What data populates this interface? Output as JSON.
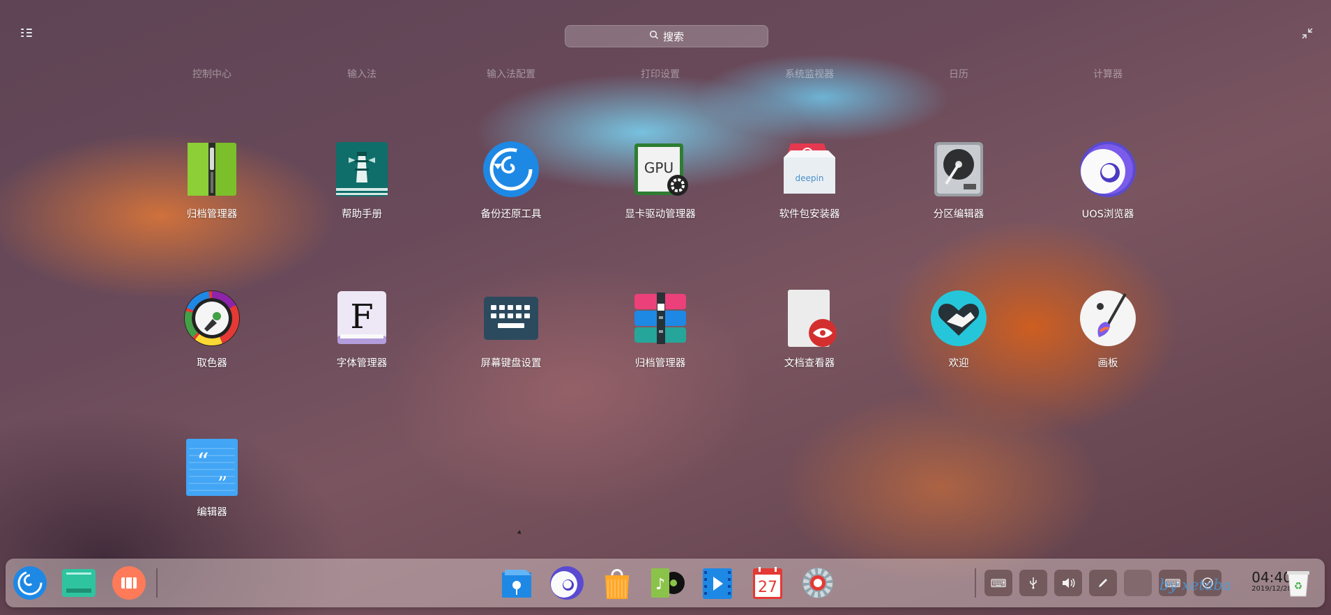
{
  "search": {
    "label": "搜索",
    "icon": "search-icon"
  },
  "categories": [
    "控制中心",
    "输入法",
    "输入法配置",
    "打印设置",
    "系统监视器",
    "日历",
    "计算器"
  ],
  "apps": [
    {
      "label": "归档管理器",
      "icon": "archive-manager-icon"
    },
    {
      "label": "帮助手册",
      "icon": "help-manual-icon"
    },
    {
      "label": "备份还原工具",
      "icon": "backup-restore-icon"
    },
    {
      "label": "显卡驱动管理器",
      "icon": "gpu-driver-manager-icon"
    },
    {
      "label": "软件包安装器",
      "icon": "package-installer-icon"
    },
    {
      "label": "分区编辑器",
      "icon": "partition-editor-icon"
    },
    {
      "label": "UOS浏览器",
      "icon": "uos-browser-icon"
    },
    {
      "label": "取色器",
      "icon": "color-picker-icon"
    },
    {
      "label": "字体管理器",
      "icon": "font-manager-icon"
    },
    {
      "label": "屏幕键盘设置",
      "icon": "onscreen-keyboard-icon"
    },
    {
      "label": "归档管理器",
      "icon": "archive-manager-alt-icon"
    },
    {
      "label": "文档查看器",
      "icon": "document-viewer-icon"
    },
    {
      "label": "欢迎",
      "icon": "welcome-icon"
    },
    {
      "label": "画板",
      "icon": "draw-icon"
    },
    {
      "label": "编辑器",
      "icon": "text-editor-icon"
    }
  ],
  "dock": {
    "calendar_day": "27",
    "pinned": [
      "launcher-icon",
      "multitasking-icon",
      "show-desktop-icon",
      "file-manager-icon",
      "browser-icon",
      "app-store-icon",
      "music-icon",
      "movie-icon",
      "calendar-icon",
      "control-center-icon"
    ],
    "tray": [
      "keyboard-layout-icon",
      "usb-icon",
      "volume-icon",
      "pen-icon",
      "notification-icon",
      "onscreen-keyboard-icon",
      "network-icon"
    ],
    "clock_time": "04:40",
    "clock_date": "2019/12/28",
    "watermark": "by xetaba",
    "trash": "trash-icon"
  },
  "colors": {
    "accent_blue": "#1e88e5",
    "dock_bg": "#e6d7d7"
  }
}
